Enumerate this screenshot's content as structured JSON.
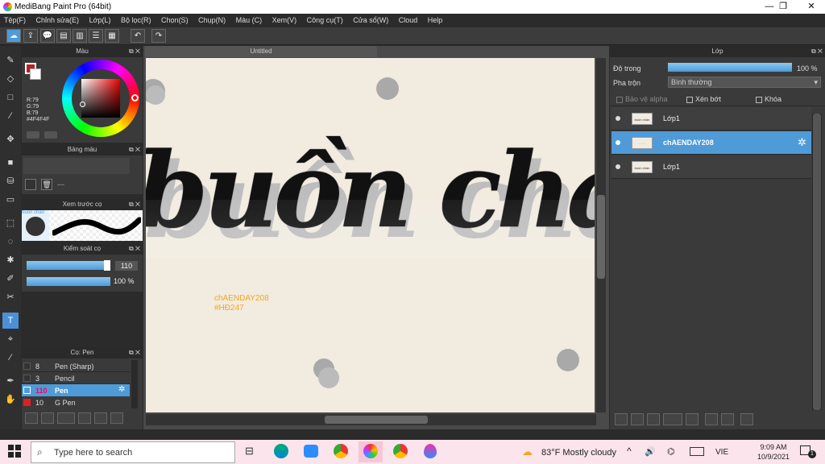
{
  "app": {
    "title": "MediBang Paint Pro (64bit)",
    "window_controls": [
      "—",
      "❐",
      "✕"
    ]
  },
  "menu": [
    "Tệp(F)",
    "Chỉnh sửa(E)",
    "Lớp(L)",
    "Bộ lọc(R)",
    "Chọn(S)",
    "Chụp(N)",
    "Màu (C)",
    "Xem(V)",
    "Công cụ(T)",
    "Cửa sổ(W)",
    "Cloud",
    "Help"
  ],
  "color_panel": {
    "title": "Màu",
    "r": "R:79",
    "g": "G:79",
    "b": "B:79",
    "hex": "#4F4F4F",
    "fg_color": "#4f4f4f",
    "accent": "#b82020"
  },
  "palette_panel": {
    "title": "Bảng màu",
    "count": "---"
  },
  "preview_panel": {
    "title": "Xem trước cọ",
    "thumb_text": "buồn chán"
  },
  "brush_control": {
    "title": "Kiểm soát cọ",
    "size": "110",
    "opacity": "100 %"
  },
  "brush_panel": {
    "title": "Cọ: Pen",
    "items": [
      {
        "size": "8",
        "name": "Pen (Sharp)",
        "swatch": "#333333"
      },
      {
        "size": "3",
        "name": "Pencil",
        "swatch": "#333333"
      },
      {
        "size": "110",
        "name": "Pen",
        "swatch": "#4e9bd8"
      },
      {
        "size": "10",
        "name": "G Pen",
        "swatch": "#e02020"
      }
    ]
  },
  "document": {
    "tab": "Untitled",
    "lettering": "buồn chán",
    "credit_line1": "chAENDAY208",
    "credit_line2": "#HĐ247"
  },
  "layer_panel": {
    "title": "Lớp",
    "opacity_label": "Độ trong",
    "opacity_value": "100 %",
    "blend_label": "Pha trộn",
    "blend_value": "Bình thường",
    "protect_alpha": "Bảo vệ alpha",
    "clipping": "Xén bớt",
    "lock": "Khóa",
    "layers": [
      {
        "name": "Lớp1",
        "thumb": "buồn chán"
      },
      {
        "name": "chAENDAY208",
        "thumb": "~~~~"
      },
      {
        "name": "Lớp1",
        "thumb": "buồn chán"
      }
    ]
  },
  "taskbar": {
    "search_placeholder": "Type here to search",
    "weather": "83°F  Mostly cloudy",
    "lang": "VIE",
    "time": "9:09 AM",
    "date": "10/9/2021",
    "notif_count": "1"
  }
}
